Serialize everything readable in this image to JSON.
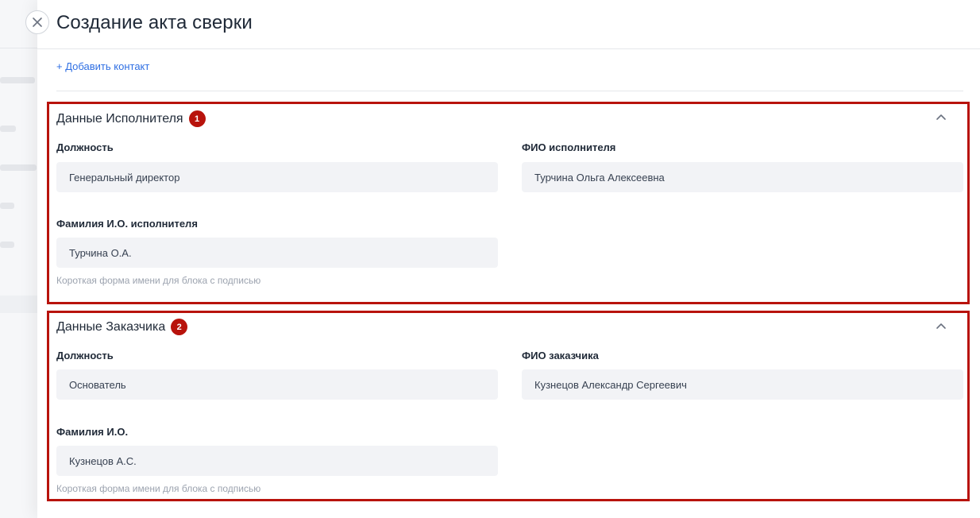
{
  "header": {
    "title": "Создание акта сверки"
  },
  "actions": {
    "add_contact": "+ Добавить контакт"
  },
  "sections": [
    {
      "title": "Данные Исполнителя",
      "badge": "1",
      "fields": {
        "position_label": "Должность",
        "position_value": "Генеральный директор",
        "fullname_label": "ФИО исполнителя",
        "fullname_value": "Турчина Ольга Алексеевна",
        "short_label": "Фамилия И.О. исполнителя",
        "short_value": "Турчина О.А.",
        "hint": "Короткая форма имени для блока с подписью"
      }
    },
    {
      "title": "Данные Заказчика",
      "badge": "2",
      "fields": {
        "position_label": "Должность",
        "position_value": "Основатель",
        "fullname_label": "ФИО заказчика",
        "fullname_value": "Кузнецов Александр Сергеевич",
        "short_label": "Фамилия И.О.",
        "short_value": "Кузнецов А.С.",
        "hint": "Короткая форма имени для блока с подписью"
      }
    }
  ],
  "icons": {
    "close": "close-icon",
    "collapse": "chevron-up-icon"
  },
  "colors": {
    "accent": "#2f6fe3",
    "highlight": "#b8130c",
    "field_bg": "#f2f3f6"
  }
}
